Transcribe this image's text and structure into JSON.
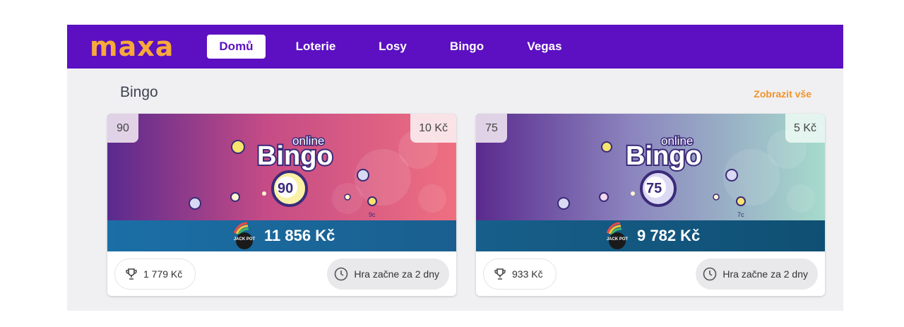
{
  "brand": {
    "logo_text": "maxa"
  },
  "nav": {
    "items": [
      {
        "label": "Domů",
        "active": true
      },
      {
        "label": "Loterie"
      },
      {
        "label": "Losy"
      },
      {
        "label": "Bingo"
      },
      {
        "label": "Vegas"
      }
    ]
  },
  "section": {
    "title": "Bingo",
    "show_all": "Zobrazit vše"
  },
  "cards": [
    {
      "game_number": "90",
      "ticket_price": "10 Kč",
      "logo_online": "online",
      "logo_bingo": "Bingo",
      "logo_ball": "90",
      "jackpot_icon_text": "JACK POT",
      "jackpot": "11 856 Kč",
      "prize": "1 779 Kč",
      "start": "Hra začne za 2 dny",
      "colors": {
        "banner_start": "#5a2a8e",
        "banner_end": "#ef6f80",
        "strip": "#1b6fa6"
      }
    },
    {
      "game_number": "75",
      "ticket_price": "5 Kč",
      "logo_online": "online",
      "logo_bingo": "Bingo",
      "logo_ball": "75",
      "jackpot_icon_text": "JACK POT",
      "jackpot": "9 782 Kč",
      "prize": "933 Kč",
      "start": "Hra začne za 2 dny",
      "colors": {
        "banner_start": "#5a2a8e",
        "banner_end": "#a6dbcc",
        "strip": "#155f86"
      }
    }
  ],
  "colors": {
    "nav_bg": "#5c10c2",
    "logo": "#f7a93a",
    "link": "#f0932b"
  }
}
